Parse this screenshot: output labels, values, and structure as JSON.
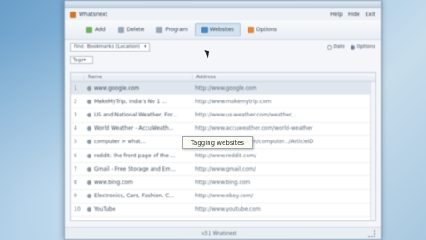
{
  "window": {
    "title": "",
    "app_name": "Whatsnext",
    "menus": [
      "Help",
      "Hide",
      "Exit"
    ]
  },
  "toolbar": {
    "items": [
      {
        "label": "Add",
        "icon": "add-icon"
      },
      {
        "label": "Delete",
        "icon": "delete-icon"
      },
      {
        "label": "Program",
        "icon": "program-icon"
      },
      {
        "label": "Websites",
        "icon": "globe-icon",
        "active": true
      },
      {
        "label": "Options",
        "icon": "options-icon"
      }
    ]
  },
  "filter": {
    "select_value": "Find: Bookmarks (Location)",
    "date_label": "Date",
    "options_label": "Options"
  },
  "tag": {
    "label": "Tags"
  },
  "table": {
    "columns": [
      "Name",
      "Address"
    ],
    "rows": [
      {
        "num": "1",
        "name": "www.google.com",
        "address": "http://www.google.com"
      },
      {
        "num": "2",
        "name": "MakeMyTrip, India's No 1 ...",
        "address": "http://www.makemytrip.com"
      },
      {
        "num": "3",
        "name": "US and National Weather, For...",
        "address": "http://www.us.weather.com/weather..."
      },
      {
        "num": "4",
        "name": "World Weather - AccuWeath...",
        "address": "http://www.accuweather.com/world-weather"
      },
      {
        "num": "5",
        "name": "computer > what...",
        "address": "http://www.google.com/computer.../ArticleID"
      },
      {
        "num": "6",
        "name": "reddit: the front page of the ...",
        "address": "http://www.reddit.com/"
      },
      {
        "num": "7",
        "name": "Gmail - Free Storage and Em...",
        "address": "http://www.gmail.com/"
      },
      {
        "num": "8",
        "name": "www.bing.com",
        "address": "http://www.bing.com"
      },
      {
        "num": "9",
        "name": "Electronics, Cars, Fashion, C...",
        "address": "http://www.ebay.com/"
      },
      {
        "num": "10",
        "name": "YouTube",
        "address": "http://www.youtube.com"
      }
    ]
  },
  "tooltip": {
    "text": "Tagging websites"
  },
  "status": {
    "left": "",
    "right": "v3.1 Whatsnext"
  }
}
